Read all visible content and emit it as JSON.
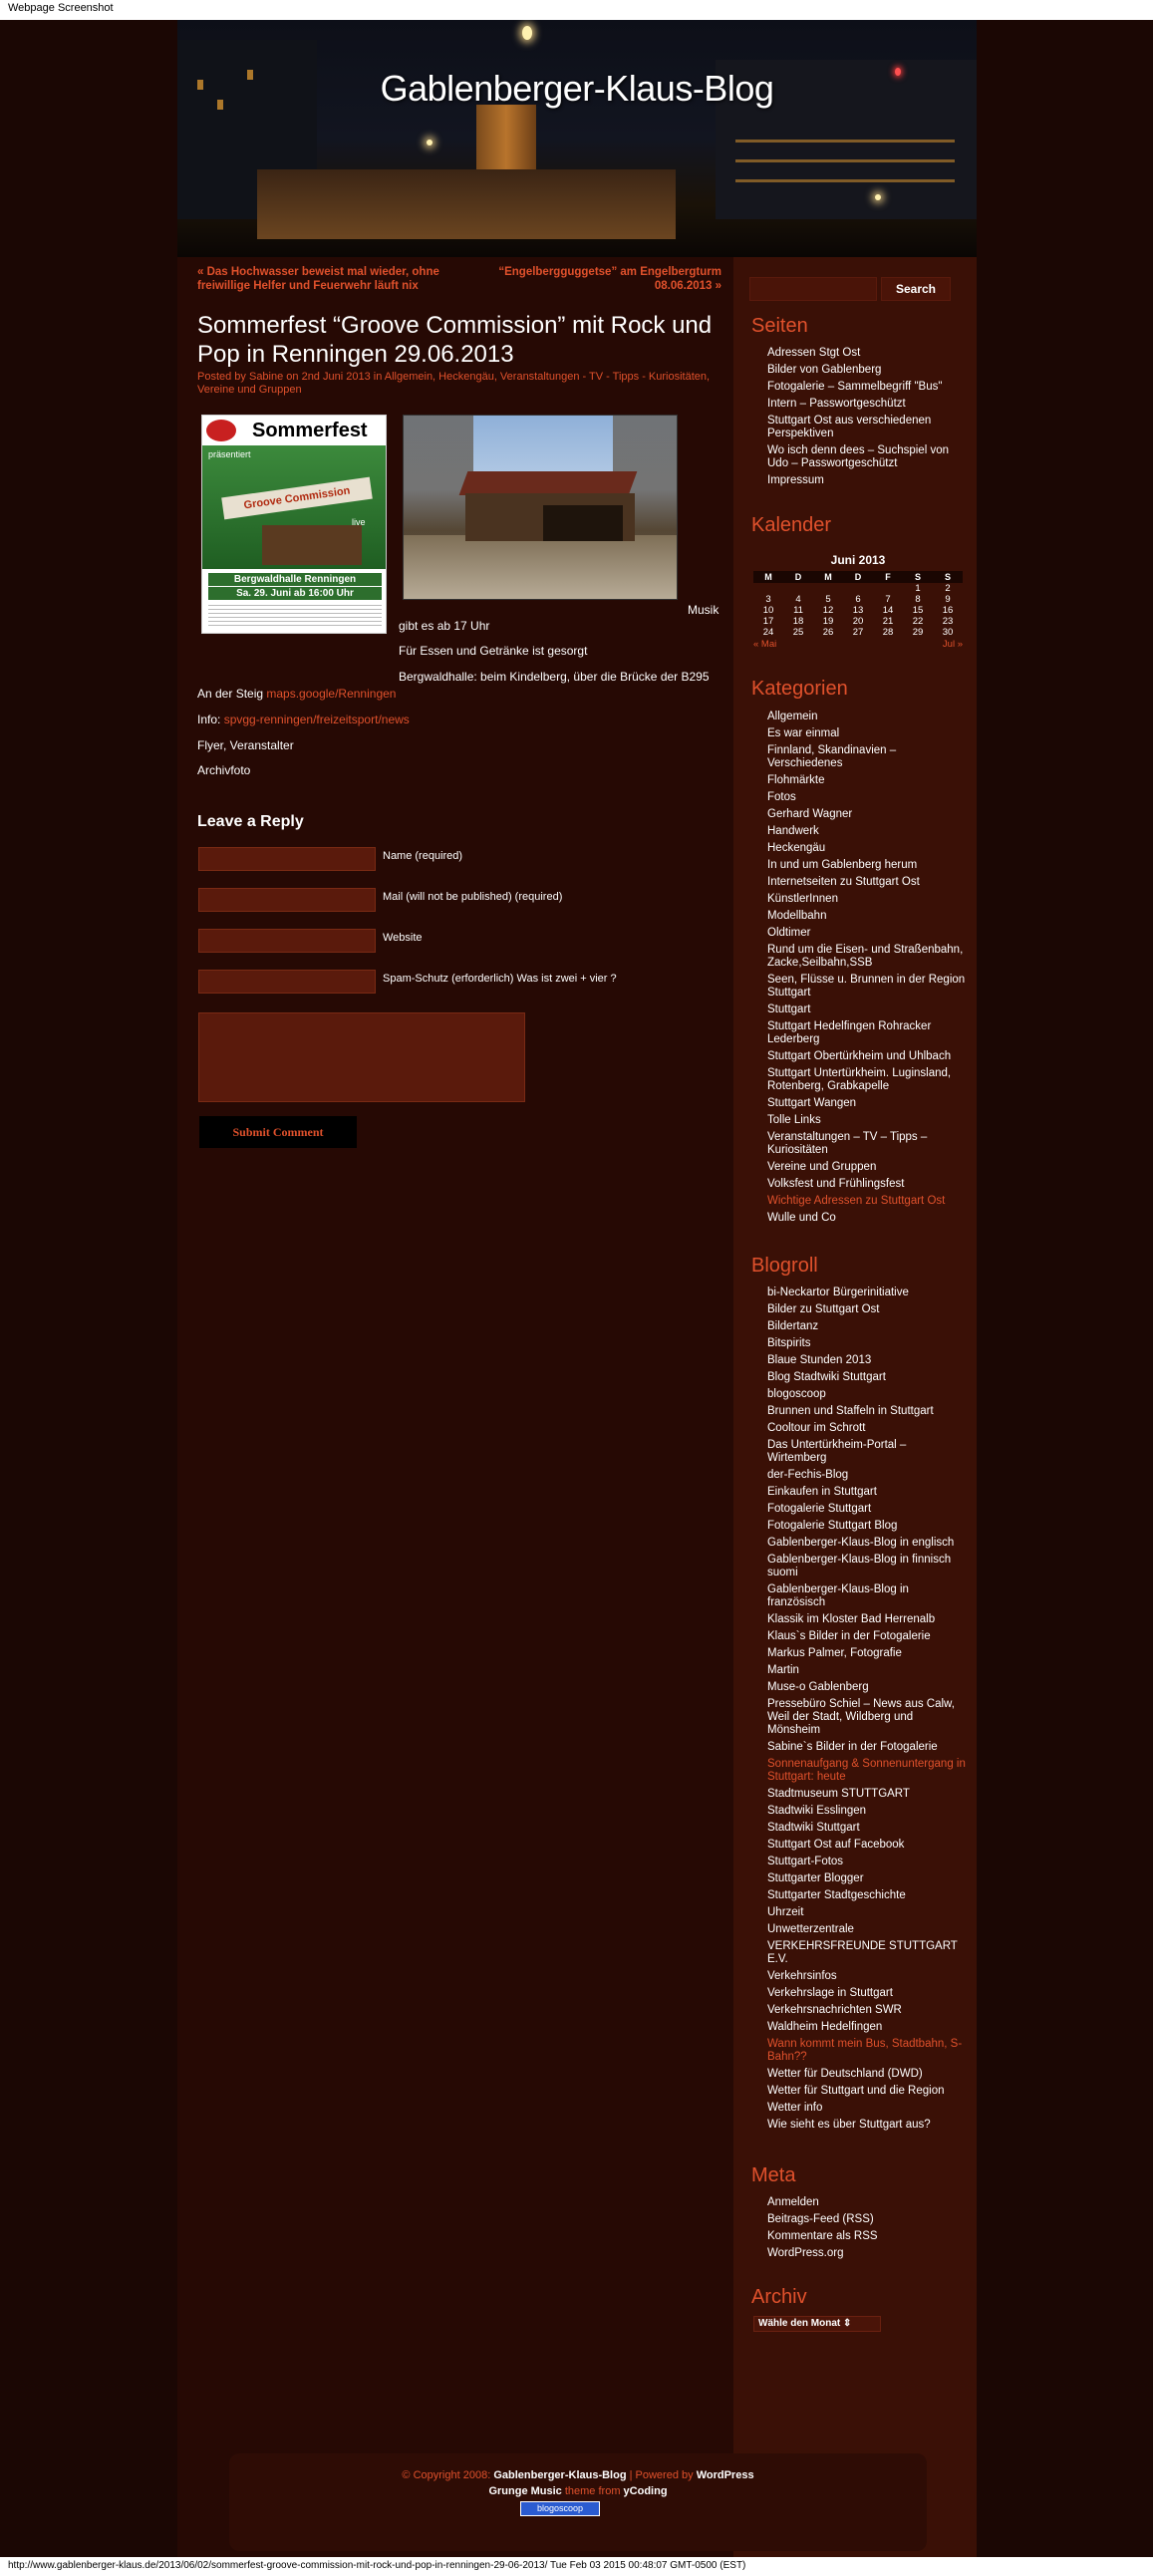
{
  "browser": {
    "caption": "Webpage Screenshot",
    "status_line": "http://www.gablenberger-klaus.de/2013/06/02/sommerfest-groove-commission-mit-rock-und-pop-in-renningen-29-06-2013/ Tue Feb 03 2015 00:48:07 GMT-0500 (EST)"
  },
  "header": {
    "title": "Gablenberger-Klaus-Blog"
  },
  "post_nav": {
    "prev_1": "« Das Hochwasser beweist mal wieder, ohne",
    "prev_2": "freiwillige Helfer und Feuerwehr läuft nix",
    "next_1": "“Engelbergguggetse” am Engelbergturm",
    "next_2": "08.06.2013 »"
  },
  "post": {
    "title": "Sommerfest “Groove Commission” mit Rock und Pop in Renningen 29.06.2013",
    "meta_line1": "Posted by Sabine on 2nd Juni 2013 in Allgemein, Heckengäu, Veranstaltungen - TV - Tipps - Kuriositäten,",
    "meta_line2": "Vereine und Gruppen",
    "flyer": {
      "heading": "Sommerfest",
      "presents": "präsentiert",
      "band": "Groove Commission",
      "live": "live",
      "venue": "Bergwaldhalle Renningen",
      "date": "Sa. 29. Juni ab 16:00 Uhr"
    },
    "musik_word": "Musik",
    "p1": "gibt es ab 17 Uhr",
    "p2": "Für Essen und Getränke ist gesorgt",
    "p3": "Bergwaldhalle: beim Kindelberg, über die Brücke der B295",
    "p4_text": "An der Steig ",
    "p4_link": "maps.google/Renningen",
    "p5_text": "Info: ",
    "p5_link": "spvgg-renningen/freizeitsport/news",
    "p6": "Flyer, Veranstalter",
    "p7": "Archivfoto"
  },
  "reply": {
    "title": "Leave a Reply",
    "name_label": "Name (required)",
    "mail_label": "Mail (will not be published) (required)",
    "website_label": "Website",
    "spam_label": "Spam-Schutz (erforderlich) Was ist zwei + vier ?",
    "submit_label": "Submit Comment"
  },
  "sidebar": {
    "search_label": "Search",
    "seiten_title": "Seiten",
    "seiten": [
      "Adressen Stgt Ost",
      "Bilder von Gablenberg",
      "Fotogalerie – Sammelbegriff \"Bus\"",
      "Intern – Passwortgeschützt",
      "Stuttgart Ost aus verschiedenen Perspektiven",
      "Wo isch denn dees – Suchspiel von Udo – Passwortgeschützt",
      "Impressum"
    ],
    "kalender_title": "Kalender",
    "calendar": {
      "caption": "Juni 2013",
      "days": [
        "M",
        "D",
        "M",
        "D",
        "F",
        "S",
        "S"
      ],
      "weeks": [
        [
          "",
          "",
          "",
          "",
          "",
          "1",
          "2"
        ],
        [
          "3",
          "4",
          "5",
          "6",
          "7",
          "8",
          "9"
        ],
        [
          "10",
          "11",
          "12",
          "13",
          "14",
          "15",
          "16"
        ],
        [
          "17",
          "18",
          "19",
          "20",
          "21",
          "22",
          "23"
        ],
        [
          "24",
          "25",
          "26",
          "27",
          "28",
          "29",
          "30"
        ]
      ],
      "prev": "« Mai",
      "next": "Jul »"
    },
    "kategorien_title": "Kategorien",
    "kategorien": [
      "Allgemein",
      "Es war einmal",
      "Finnland, Skandinavien – Verschiedenes",
      "Flohmärkte",
      "Fotos",
      "Gerhard Wagner",
      "Handwerk",
      "Heckengäu",
      "In und um Gablenberg herum",
      "Internetseiten zu Stuttgart Ost",
      "KünstlerInnen",
      "Modellbahn",
      "Oldtimer",
      "Rund um die Eisen- und Straßenbahn, Zacke,Seilbahn,SSB",
      "Seen, Flüsse u. Brunnen in der Region Stuttgart",
      "Stuttgart",
      "Stuttgart Hedelfingen Rohracker Lederberg",
      "Stuttgart Obertürkheim und Uhlbach",
      "Stuttgart Untertürkheim. Luginsland, Rotenberg, Grabkapelle",
      "Stuttgart Wangen",
      "Tolle Links",
      "Veranstaltungen – TV – Tipps – Kuriositäten",
      "Vereine und Gruppen",
      "Volksfest und Frühlingsfest",
      "Wichtige Adressen zu Stuttgart Ost",
      "Wulle und Co"
    ],
    "blogroll_title": "Blogroll",
    "blogroll": [
      "bi-Neckartor Bürgerinitiative",
      "Bilder zu Stuttgart Ost",
      "Bildertanz",
      "Bitspirits",
      "Blaue Stunden 2013",
      "Blog Stadtwiki Stuttgart",
      "blogoscoop",
      "Brunnen und Staffeln in Stuttgart",
      "Cooltour im Schrott",
      "Das Untertürkheim-Portal – Wirtemberg",
      "der-Fechis-Blog",
      "Einkaufen in Stuttgart",
      "Fotogalerie Stuttgart",
      "Fotogalerie Stuttgart Blog",
      "Gablenberger-Klaus-Blog in englisch",
      "Gablenberger-Klaus-Blog in finnisch suomi",
      "Gablenberger-Klaus-Blog in französisch",
      "Klassik im Kloster Bad Herrenalb",
      "Klaus`s Bilder in der Fotogalerie",
      "Markus Palmer, Fotografie",
      "Martin",
      "Muse-o Gablenberg",
      "Pressebüro Schiel – News aus Calw, Weil der Stadt, Wildberg und Mönsheim",
      "Sabine`s Bilder in der Fotogalerie",
      "Sonnenaufgang & Sonnenuntergang in Stuttgart: heute",
      "Stadtmuseum STUTTGART",
      "Stadtwiki Esslingen",
      "Stadtwiki Stuttgart",
      "Stuttgart Ost auf Facebook",
      "Stuttgart-Fotos",
      "Stuttgarter Blogger",
      "Stuttgarter Stadtgeschichte",
      "Uhrzeit",
      "Unwetterzentrale",
      "VERKEHRSFREUNDE STUTTGART E.V.",
      "Verkehrsinfos",
      "Verkehrslage in Stuttgart",
      "Verkehrsnachrichten SWR",
      "Waldheim Hedelfingen",
      "Wann kommt mein Bus, Stadtbahn, S-Bahn??",
      "Wetter für Deutschland (DWD)",
      "Wetter für Stuttgart und die Region",
      "Wetter info",
      "Wie sieht es über Stuttgart aus?"
    ],
    "meta_title": "Meta",
    "meta": [
      "Anmelden",
      "Beitrags-Feed (RSS)",
      "Kommentare als RSS",
      "WordPress.org"
    ],
    "archiv_title": "Archiv",
    "archiv_select": "Wähle den Monat"
  },
  "footer": {
    "copyright": "© Copyright 2008: ",
    "blog_name": "Gablenberger-Klaus-Blog",
    "powered": " | Powered by ",
    "wordpress": "WordPress",
    "theme": "Grunge Music",
    "theme_from": " theme from ",
    "author": "yCoding",
    "badge": "blogoscoop"
  },
  "colors": {
    "accent": "#e0512c",
    "background": "#2a0b05",
    "sidebar": "#3a1006"
  }
}
